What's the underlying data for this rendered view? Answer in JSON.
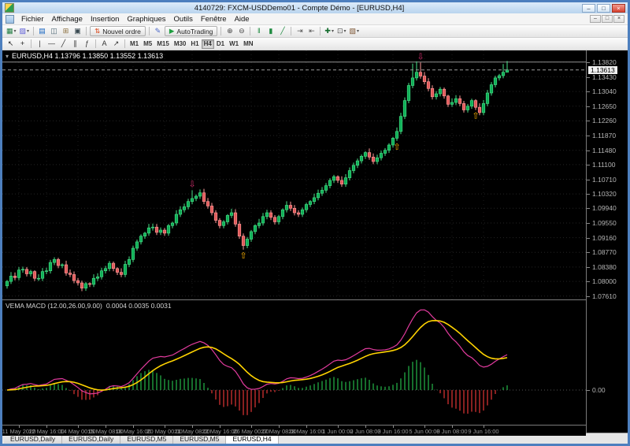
{
  "window": {
    "title": "4140729: FXCM-USDDemo01 - Compte Démo - [EURUSD,H4]",
    "controls": [
      {
        "name": "minimize-button",
        "glyph": "–"
      },
      {
        "name": "maximize-button",
        "glyph": "□"
      },
      {
        "name": "close-button",
        "glyph": "×"
      }
    ]
  },
  "menu": {
    "items": [
      "Fichier",
      "Affichage",
      "Insertion",
      "Graphiques",
      "Outils",
      "Fenêtre",
      "Aide"
    ],
    "mdi_controls": [
      {
        "name": "mdi-minimize-icon",
        "glyph": "–"
      },
      {
        "name": "mdi-restore-icon",
        "glyph": "□"
      },
      {
        "name": "mdi-close-icon",
        "glyph": "×"
      }
    ]
  },
  "toolbar_main": {
    "items": [
      {
        "type": "icon",
        "name": "new-chart-icon",
        "glyph": "▦",
        "color": "#1b7a3d",
        "dropdown": true
      },
      {
        "type": "icon",
        "name": "profiles-icon",
        "glyph": "▨",
        "color": "#5b5bd6",
        "dropdown": true
      },
      {
        "type": "sep"
      },
      {
        "type": "icon",
        "name": "market-watch-icon",
        "glyph": "▤",
        "color": "#1464c0"
      },
      {
        "type": "icon",
        "name": "data-window-icon",
        "glyph": "◫",
        "color": "#4a6572"
      },
      {
        "type": "icon",
        "name": "navigator-icon",
        "glyph": "⊞",
        "color": "#8a6d3b"
      },
      {
        "type": "icon",
        "name": "terminal-icon",
        "glyph": "▣",
        "color": "#37474f"
      },
      {
        "type": "sep"
      },
      {
        "type": "button",
        "name": "new-order-button",
        "glyph": "⇅",
        "color": "#d84315",
        "label": "Nouvel ordre"
      },
      {
        "type": "sep"
      },
      {
        "type": "icon",
        "name": "metaeditor-icon",
        "glyph": "✎",
        "color": "#4a66c8"
      },
      {
        "type": "button",
        "name": "autotrading-button",
        "glyph": "▶",
        "color": "#1d9e3f",
        "label": "AutoTrading"
      },
      {
        "type": "sep"
      },
      {
        "type": "icon",
        "name": "zoom-in-icon",
        "glyph": "⊕",
        "color": "#444444"
      },
      {
        "type": "icon",
        "name": "zoom-out-icon",
        "glyph": "⊖",
        "color": "#444444"
      },
      {
        "type": "sep"
      },
      {
        "type": "icon",
        "name": "bar-chart-icon",
        "glyph": "‖",
        "color": "#1d8a3f"
      },
      {
        "type": "icon",
        "name": "candlestick-chart-icon",
        "glyph": "▮",
        "color": "#1d8a3f"
      },
      {
        "type": "icon",
        "name": "line-chart-icon",
        "glyph": "╱",
        "color": "#1d8a3f"
      },
      {
        "type": "sep"
      },
      {
        "type": "icon",
        "name": "auto-scroll-icon",
        "glyph": "⇥",
        "color": "#555555"
      },
      {
        "type": "icon",
        "name": "chart-shift-icon",
        "glyph": "⇤",
        "color": "#555555"
      },
      {
        "type": "sep"
      },
      {
        "type": "icon",
        "name": "indicators-icon",
        "glyph": "✚",
        "color": "#166d2f",
        "dropdown": true
      },
      {
        "type": "icon",
        "name": "periods-icon",
        "glyph": "⊡",
        "color": "#555555",
        "dropdown": true
      },
      {
        "type": "icon",
        "name": "templates-icon",
        "glyph": "▧",
        "color": "#7a5230",
        "dropdown": true
      }
    ]
  },
  "toolbar_draw": {
    "items": [
      {
        "type": "icon",
        "name": "cursor-icon",
        "glyph": "↖",
        "color": "#222222"
      },
      {
        "type": "icon",
        "name": "crosshair-icon",
        "glyph": "+",
        "color": "#222222"
      },
      {
        "type": "sep"
      },
      {
        "type": "icon",
        "name": "vertical-line-icon",
        "glyph": "|",
        "color": "#333333"
      },
      {
        "type": "icon",
        "name": "horizontal-line-icon",
        "glyph": "—",
        "color": "#333333"
      },
      {
        "type": "icon",
        "name": "trendline-icon",
        "glyph": "╱",
        "color": "#333333"
      },
      {
        "type": "icon",
        "name": "channel-icon",
        "glyph": "∥",
        "color": "#333333"
      },
      {
        "type": "icon",
        "name": "fibonacci-icon",
        "glyph": "ƒ",
        "color": "#333333"
      },
      {
        "type": "sep"
      },
      {
        "type": "icon",
        "name": "text-label-icon",
        "glyph": "A",
        "color": "#333333"
      },
      {
        "type": "icon",
        "name": "arrows-icon",
        "glyph": "↗",
        "color": "#333333"
      },
      {
        "type": "sep"
      }
    ],
    "timeframes": [
      "M1",
      "M5",
      "M15",
      "M30",
      "H1",
      "H4",
      "D1",
      "W1",
      "MN"
    ],
    "active_timeframe": "H4"
  },
  "chart": {
    "one_click_glyph": "▾",
    "info_line": "EURUSD,H4  1.13796 1.13850 1.13552 1.13613"
  },
  "indicator_window": {
    "label": "VEMA MACD (12.00,26.00,9.00)",
    "values": "0.0004 0.0035 0.0031",
    "zero_label": "0.00"
  },
  "price_scale": {
    "labels": [
      "1.13820",
      "1.13430",
      "1.13040",
      "1.12650",
      "1.12260",
      "1.11870",
      "1.11480",
      "1.11100",
      "1.10710",
      "1.10320",
      "1.09940",
      "1.09550",
      "1.09160",
      "1.08770",
      "1.08380",
      "1.08000",
      "1.07610"
    ],
    "current": "1.13613"
  },
  "time_axis": {
    "labels": [
      {
        "text": "11 May 2020",
        "index": 3
      },
      {
        "text": "12 May 16:00",
        "index": 10
      },
      {
        "text": "14 May 00:00",
        "index": 18
      },
      {
        "text": "15 May 08:00",
        "index": 25
      },
      {
        "text": "18 May 16:00",
        "index": 32
      },
      {
        "text": "20 May 00:00",
        "index": 40
      },
      {
        "text": "21 May 08:00",
        "index": 47
      },
      {
        "text": "22 May 16:00",
        "index": 54
      },
      {
        "text": "26 May 00:00",
        "index": 62
      },
      {
        "text": "27 May 08:00",
        "index": 69
      },
      {
        "text": "28 May 16:00",
        "index": 76
      },
      {
        "text": "1 Jun 00:00",
        "index": 84
      },
      {
        "text": "2 Jun 08:00",
        "index": 91
      },
      {
        "text": "3 Jun 16:00",
        "index": 98
      },
      {
        "text": "5 Jun 00:00",
        "index": 106
      },
      {
        "text": "8 Jun 08:00",
        "index": 113
      },
      {
        "text": "9 Jun 16:00",
        "index": 121
      }
    ]
  },
  "tabs": {
    "items": [
      "EURUSD,Daily",
      "EURUSD,Daily",
      "EURUSD,M5",
      "EURUSD,M5",
      "EURUSD,H4"
    ],
    "active_index": 4
  },
  "chart_data": {
    "type": "candlestick",
    "symbol": "EURUSD",
    "timeframe": "H4",
    "title": "EURUSD,H4",
    "y_range": [
      1.0752,
      1.1413
    ],
    "closes": [
      1.08,
      1.0814,
      1.081,
      1.083,
      1.0832,
      1.082,
      1.0826,
      1.0808,
      1.0808,
      1.0826,
      1.0828,
      1.085,
      1.0858,
      1.0842,
      1.0844,
      1.0822,
      1.0818,
      1.0802,
      1.0796,
      1.0782,
      1.0794,
      1.0792,
      1.0808,
      1.0812,
      1.0828,
      1.0834,
      1.0848,
      1.0834,
      1.0824,
      1.0818,
      1.0845,
      1.0858,
      1.0888,
      1.0905,
      1.092,
      1.0928,
      1.0942,
      1.0944,
      1.093,
      1.0936,
      1.0928,
      1.0948,
      1.0955,
      1.0978,
      1.099,
      1.0998,
      1.1012,
      1.102,
      1.1026,
      1.1035,
      1.1012,
      1.1,
      1.0982,
      1.0962,
      1.0948,
      1.0958,
      1.0975,
      1.0982,
      1.0952,
      1.092,
      1.0895,
      1.0912,
      1.0932,
      1.0948,
      1.0955,
      1.0972,
      1.0982,
      1.097,
      1.0958,
      1.0972,
      1.099,
      1.1002,
      1.0994,
      1.0982,
      1.0978,
      1.099,
      1.1004,
      1.1012,
      1.1022,
      1.1034,
      1.1042,
      1.1054,
      1.1068,
      1.1078,
      1.1068,
      1.1058,
      1.1075,
      1.1094,
      1.1108,
      1.112,
      1.1132,
      1.1142,
      1.113,
      1.1118,
      1.1128,
      1.114,
      1.1148,
      1.1162,
      1.118,
      1.1198,
      1.1238,
      1.128,
      1.132,
      1.134,
      1.1355,
      1.1345,
      1.133,
      1.1312,
      1.129,
      1.1298,
      1.131,
      1.1292,
      1.127,
      1.1275,
      1.1285,
      1.1272,
      1.1255,
      1.1265,
      1.128,
      1.1262,
      1.1248,
      1.1272,
      1.13,
      1.1322,
      1.134,
      1.1346,
      1.1355,
      1.13613
    ],
    "high_overrides": {
      "47": 1.1042,
      "49": 1.1044,
      "103": 1.1378,
      "104": 1.1384,
      "105": 1.1381,
      "126": 1.1377,
      "127": 1.1385
    },
    "low_overrides": {
      "19": 1.0774,
      "60": 1.0884,
      "127": 1.13552
    },
    "markers": [
      {
        "index": 47,
        "direction": "down"
      },
      {
        "index": 60,
        "direction": "up"
      },
      {
        "index": 99,
        "direction": "up"
      },
      {
        "index": 105,
        "direction": "down"
      },
      {
        "index": 119,
        "direction": "up"
      }
    ],
    "marker_glyphs": {
      "up": "⇧",
      "down": "⇩"
    },
    "bid_price": 1.13613,
    "hline_price": 1.1382,
    "macd_params": [
      12,
      26,
      9
    ],
    "colors": {
      "bull_fill": "#0fae57",
      "bull_stroke": "#49e087",
      "bear_fill": "#e05a5a",
      "bear_stroke": "#ff9a9a",
      "macd_line": "#e23b9e",
      "signal_line": "#ffd300",
      "hist_up": "#1f9e40",
      "hist_down": "#c32f2f",
      "marker_up": "#ffb300",
      "marker_down": "#d62e6e",
      "grid": "#242424"
    }
  }
}
